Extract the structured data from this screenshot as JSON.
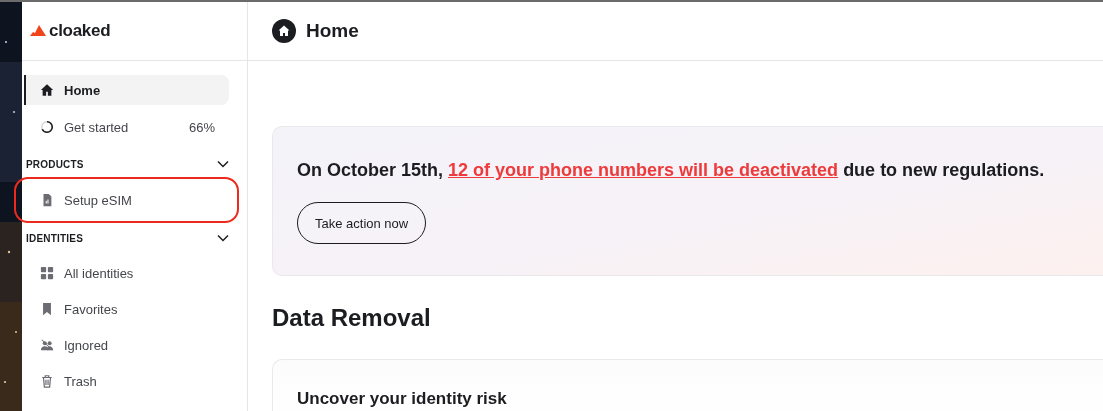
{
  "logo": {
    "text": "cloaked"
  },
  "nav": [
    {
      "label": "Home",
      "selected": true
    },
    {
      "label": "Get started",
      "selected": false,
      "level": 0.66,
      "reading": "66%"
    }
  ],
  "sections": [
    {
      "title": "PRODUCTS",
      "expanded": true,
      "items": [
        {
          "label": "Setup eSIM",
          "selected": false,
          "highlighted": true
        }
      ]
    },
    {
      "title": "IDENTITIES",
      "expanded": true,
      "items": [
        {
          "label": "All identities",
          "selected": false,
          "highlighted": false
        },
        {
          "label": "Favorites",
          "selected": false,
          "highlighted": false
        },
        {
          "label": "Ignored",
          "selected": false,
          "highlighted": false
        },
        {
          "label": "Trash",
          "selected": false,
          "highlighted": false
        }
      ]
    }
  ],
  "header": {
    "title": "Home"
  },
  "banner": {
    "before": "On October 15th, ",
    "link": "12 of your phone numbers will be deactivated",
    "after": " due to new regulations.",
    "button": "Take action now"
  },
  "data_removal": {
    "title": "Data Removal",
    "card_title": "Uncover your identity risk"
  }
}
